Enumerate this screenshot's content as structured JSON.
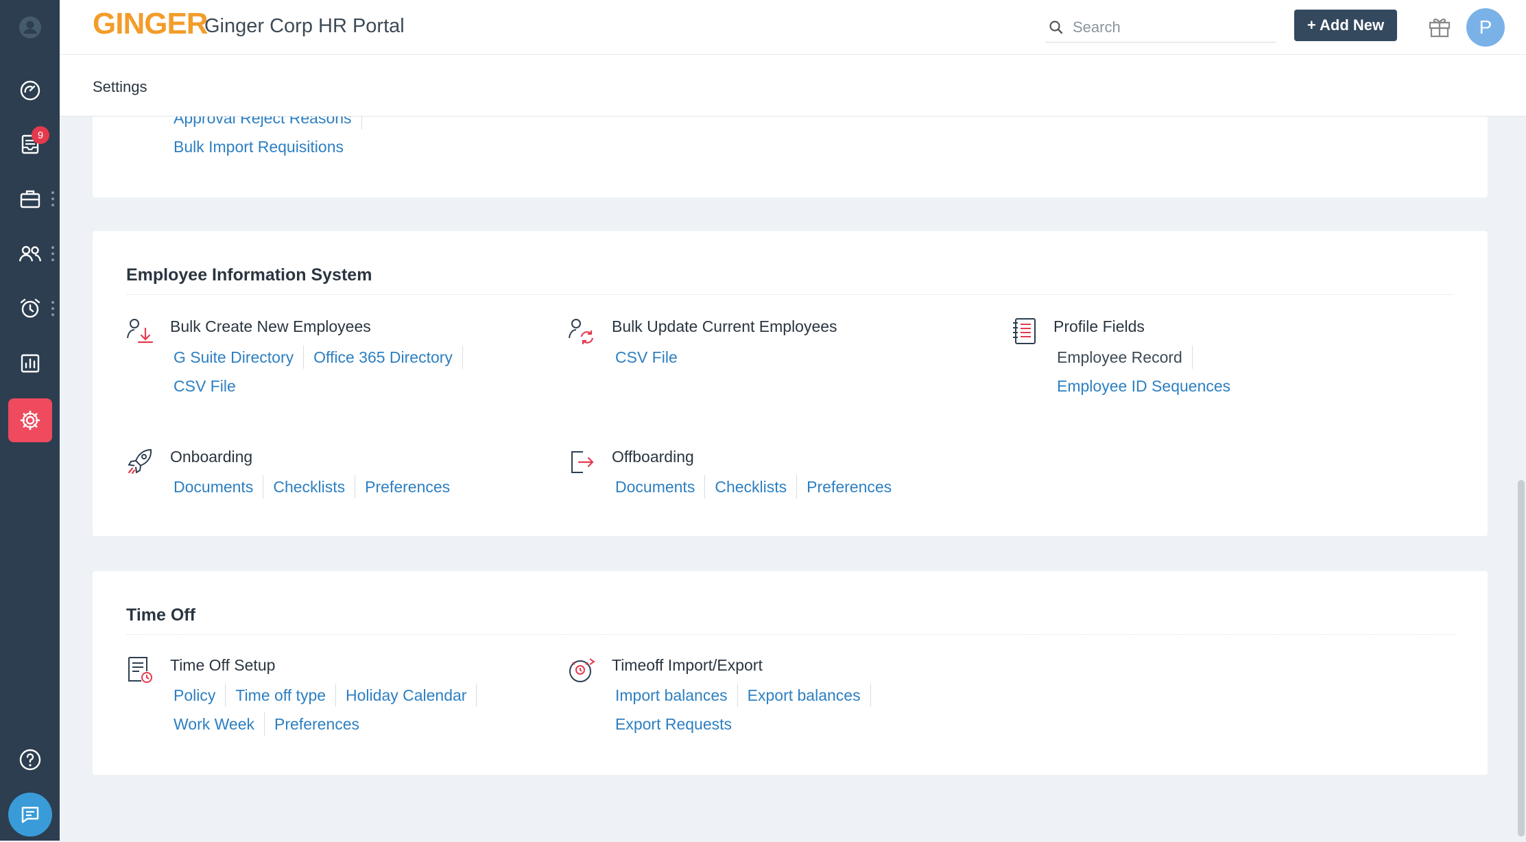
{
  "app": {
    "logo": "GINGER",
    "title": "Ginger Corp HR Portal"
  },
  "header": {
    "search_placeholder": "Search",
    "add_new_label": "+ Add New",
    "avatar_initial": "P"
  },
  "sidebar": {
    "badge_count": "9"
  },
  "page": {
    "breadcrumb": "Settings"
  },
  "requisitions": {
    "links_row1": [
      "Approval Reject Reasons"
    ],
    "links_row2": [
      "Bulk Import Requisitions"
    ]
  },
  "eis": {
    "title": "Employee Information System",
    "bulk_create": {
      "title": "Bulk Create New Employees",
      "row1": [
        "G Suite Directory",
        "Office 365 Directory"
      ],
      "row2": [
        "CSV File"
      ]
    },
    "bulk_update": {
      "title": "Bulk Update Current Employees",
      "row1": [
        "CSV File"
      ]
    },
    "profile_fields": {
      "title": "Profile Fields",
      "row1": [
        "Employee Record"
      ],
      "row2": [
        "Employee ID Sequences"
      ]
    },
    "onboarding": {
      "title": "Onboarding",
      "row1": [
        "Documents",
        "Checklists",
        "Preferences"
      ]
    },
    "offboarding": {
      "title": "Offboarding",
      "row1": [
        "Documents",
        "Checklists",
        "Preferences"
      ]
    }
  },
  "timeoff": {
    "title": "Time Off",
    "setup": {
      "title": "Time Off Setup",
      "row1": [
        "Policy",
        "Time off type",
        "Holiday Calendar"
      ],
      "row2": [
        "Work Week",
        "Preferences"
      ]
    },
    "import_export": {
      "title": "Timeoff Import/Export",
      "row1": [
        "Import balances",
        "Export balances"
      ],
      "row2": [
        "Export Requests"
      ]
    }
  },
  "colors": {
    "sidebar_bg": "#2c3e50",
    "active_nav": "#ef4a5d",
    "link": "#2d7fc1",
    "logo": "#f39c2a",
    "button": "#34495e"
  }
}
